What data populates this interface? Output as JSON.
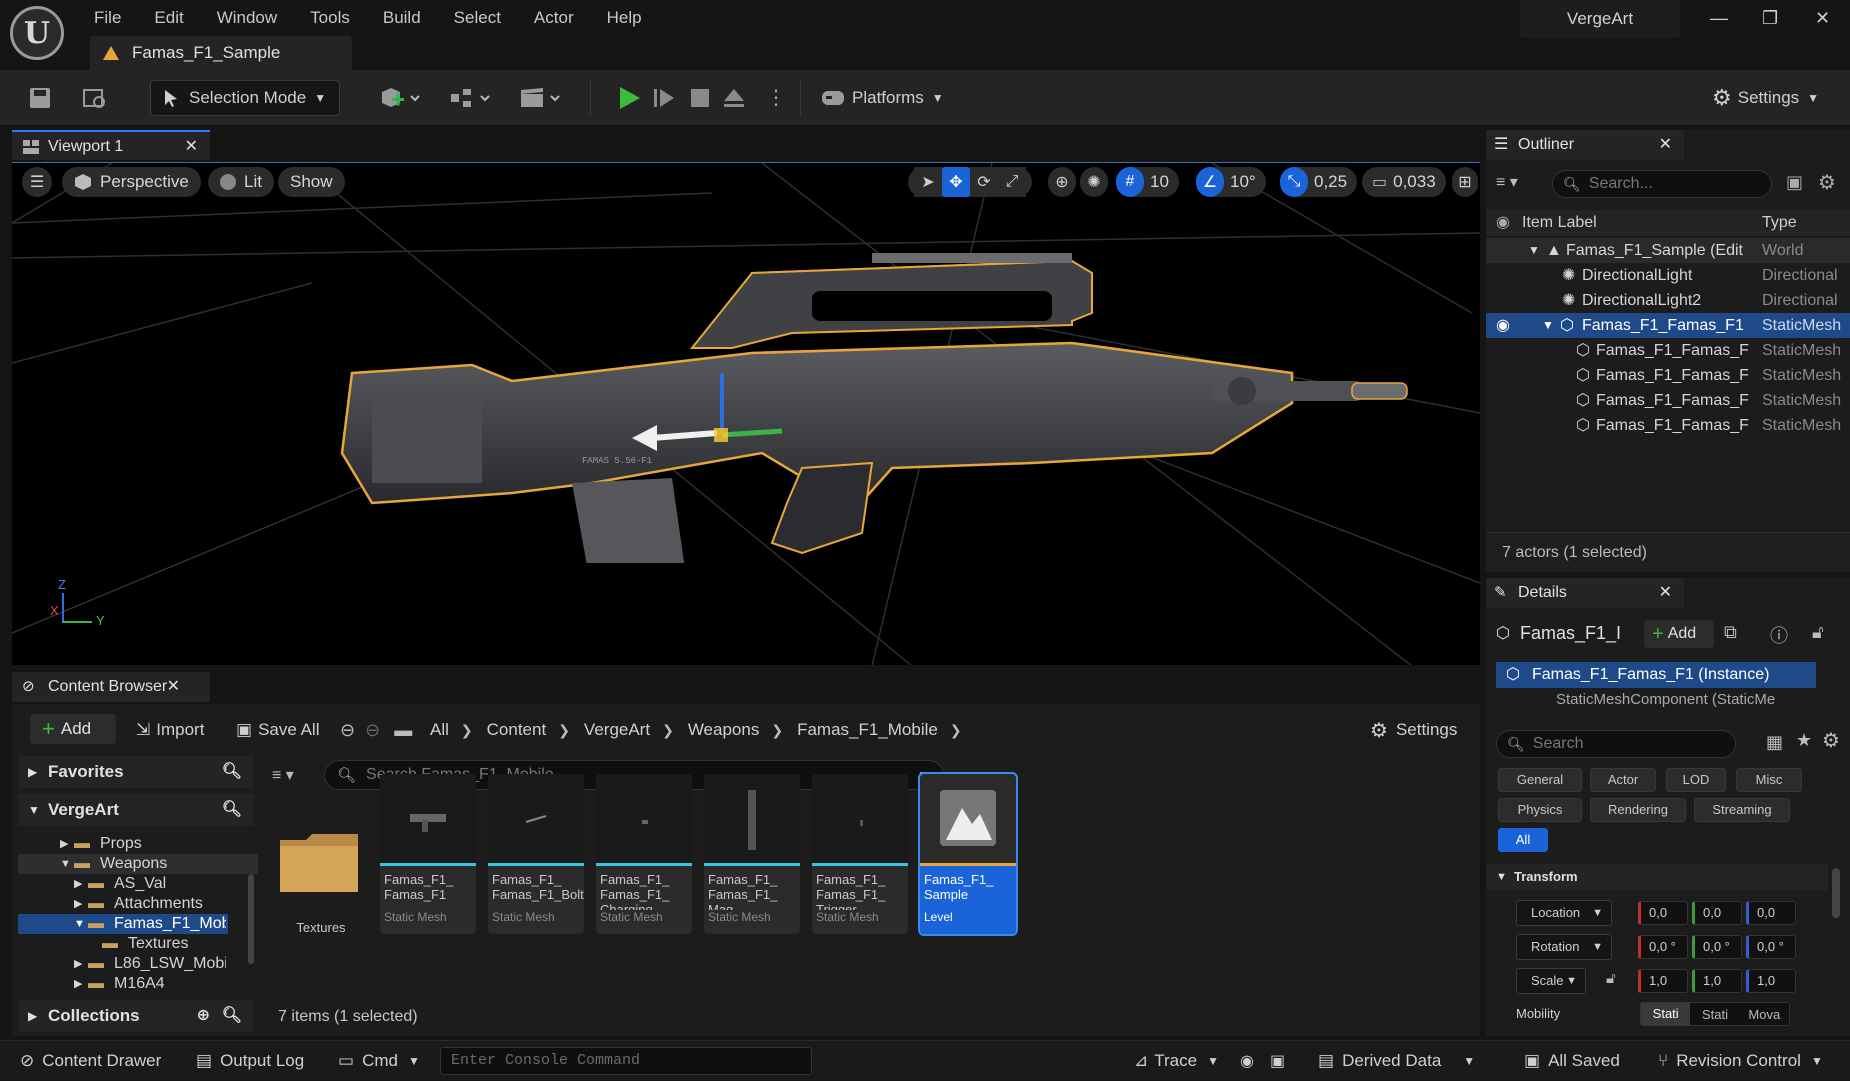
{
  "app": {
    "logo_letter": "U",
    "project_name": "VergeArt",
    "document_tab": "Famas_F1_Sample"
  },
  "menu": [
    "File",
    "Edit",
    "Window",
    "Tools",
    "Build",
    "Select",
    "Actor",
    "Help"
  ],
  "window_controls": {
    "minimize": "—",
    "restore": "❐",
    "close": "✕"
  },
  "toolbar": {
    "selection_mode": "Selection Mode",
    "platforms": "Platforms",
    "settings": "Settings"
  },
  "viewport": {
    "tab_label": "Viewport 1",
    "perspective": "Perspective",
    "lit": "Lit",
    "show": "Show",
    "grid_snap": "10",
    "rotation_snap": "10°",
    "scale_snap": "0,25",
    "camera_speed": "0,033",
    "axis_labels": {
      "z": "Z",
      "x": "X",
      "y": "Y"
    },
    "gun_engraving": "FAMAS 5.56-F1"
  },
  "outliner": {
    "tab_label": "Outliner",
    "search_placeholder": "Search...",
    "col_label": "Item Label",
    "col_type": "Type",
    "rows": [
      {
        "label": "Famas_F1_Sample (Edit",
        "type": "World"
      },
      {
        "label": "DirectionalLight",
        "type": "Directional"
      },
      {
        "label": "DirectionalLight2",
        "type": "Directional"
      },
      {
        "label": "Famas_F1_Famas_F1",
        "type": "StaticMesh"
      },
      {
        "label": "Famas_F1_Famas_F",
        "type": "StaticMesh"
      },
      {
        "label": "Famas_F1_Famas_F",
        "type": "StaticMesh"
      },
      {
        "label": "Famas_F1_Famas_F",
        "type": "StaticMesh"
      },
      {
        "label": "Famas_F1_Famas_F",
        "type": "StaticMesh"
      }
    ],
    "status": "7 actors (1 selected)"
  },
  "details": {
    "tab_label": "Details",
    "actor_name": "Famas_F1_I",
    "add": "Add",
    "instance": "Famas_F1_Famas_F1 (Instance)",
    "component": "StaticMeshComponent (StaticMe",
    "search_placeholder": "Search",
    "filters": [
      "General",
      "Actor",
      "LOD",
      "Misc",
      "Physics",
      "Rendering",
      "Streaming",
      "All"
    ],
    "section": "Transform",
    "location_label": "Location",
    "rotation_label": "Rotation",
    "scale_label": "Scale",
    "location": [
      "0,0",
      "0,0",
      "0,0"
    ],
    "rotation": [
      "0,0 °",
      "0,0 °",
      "0,0 °"
    ],
    "scale": [
      "1,0",
      "1,0",
      "1,0"
    ],
    "mobility_label": "Mobility",
    "mobility_options": [
      "Stati",
      "Stati",
      "Mova"
    ]
  },
  "content_browser": {
    "tab_label": "Content Browser",
    "add": "Add",
    "import": "Import",
    "save_all": "Save All",
    "breadcrumb": [
      "All",
      "Content",
      "VergeArt",
      "Weapons",
      "Famas_F1_Mobile"
    ],
    "settings": "Settings",
    "favorites": "Favorites",
    "project_root": "VergeArt",
    "search_placeholder": "Search Famas_F1_Mobile",
    "tree": [
      "Props",
      "Weapons",
      "AS_Val",
      "Attachments",
      "Famas_F1_Mob",
      "Textures",
      "L86_LSW_Mobi",
      "M16A4"
    ],
    "collections": "Collections",
    "folder_name": "Textures",
    "assets": [
      {
        "name": "Famas_F1_ Famas_F1",
        "kind": "Static Mesh"
      },
      {
        "name": "Famas_F1_ Famas_F1_Bolt",
        "kind": "Static Mesh"
      },
      {
        "name": "Famas_F1_ Famas_F1_ Charging",
        "kind": "Static Mesh"
      },
      {
        "name": "Famas_F1_ Famas_F1_ Mag",
        "kind": "Static Mesh"
      },
      {
        "name": "Famas_F1_ Famas_F1_ Trigger",
        "kind": "Static Mesh"
      },
      {
        "name": "Famas_F1_ Sample",
        "kind": "Level"
      }
    ],
    "item_count": "7 items (1 selected)"
  },
  "statusbar": {
    "content_drawer": "Content Drawer",
    "output_log": "Output Log",
    "cmd": "Cmd",
    "console_placeholder": "Enter Console Command",
    "trace": "Trace",
    "derived_data": "Derived Data",
    "all_saved": "All Saved",
    "revision_control": "Revision Control"
  },
  "colors": {
    "accent_blue": "#1a63d8",
    "selection_orange": "#e8a63a",
    "teal_underline": "#39c6e0"
  }
}
